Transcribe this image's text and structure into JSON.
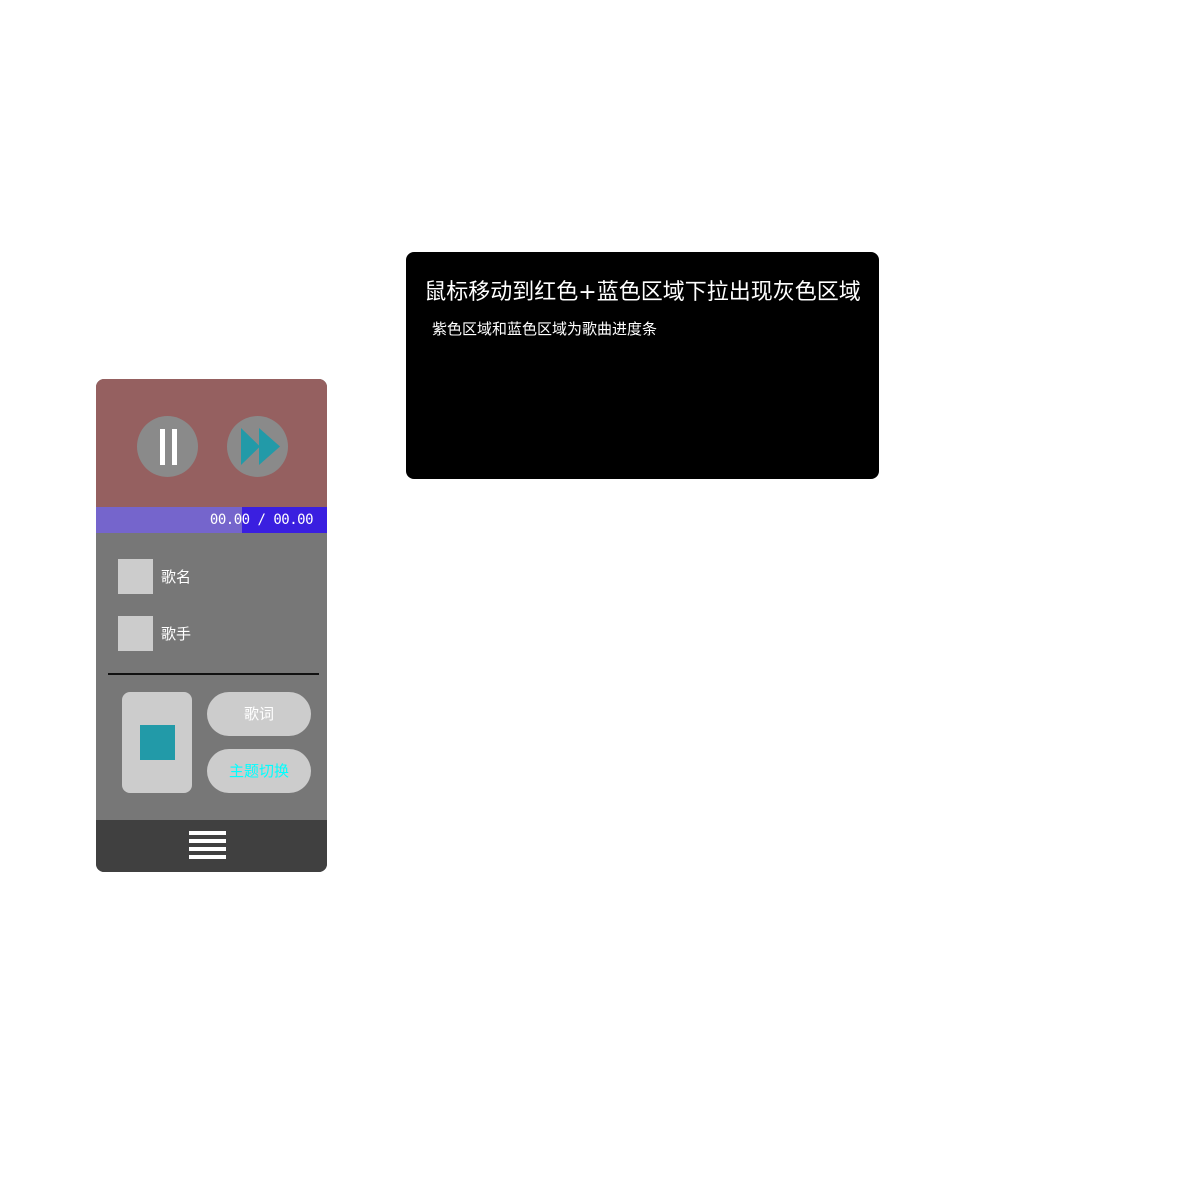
{
  "player": {
    "progress": {
      "fraction": 0.63,
      "time_text": "00.00 / 00.00"
    },
    "song_name_label": "歌名",
    "artist_label": "歌手",
    "lyrics_button_label": "歌词",
    "theme_button_label": "主题切换",
    "icons": {
      "pause": "pause-icon",
      "next": "fast-forward-icon",
      "menu": "hamburger-menu-icon"
    },
    "colors": {
      "top_panel": "#956060",
      "progress_track": "#3a1fe0",
      "progress_fill": "#7565cc",
      "body": "#777777",
      "bottom_bar": "#404040",
      "accent": "#229aa8",
      "theme_text": "#00ffff"
    }
  },
  "note": {
    "title": "鼠标移动到红色+蓝色区域下拉出现灰色区域",
    "subtitle": "紫色区域和蓝色区域为歌曲进度条"
  }
}
